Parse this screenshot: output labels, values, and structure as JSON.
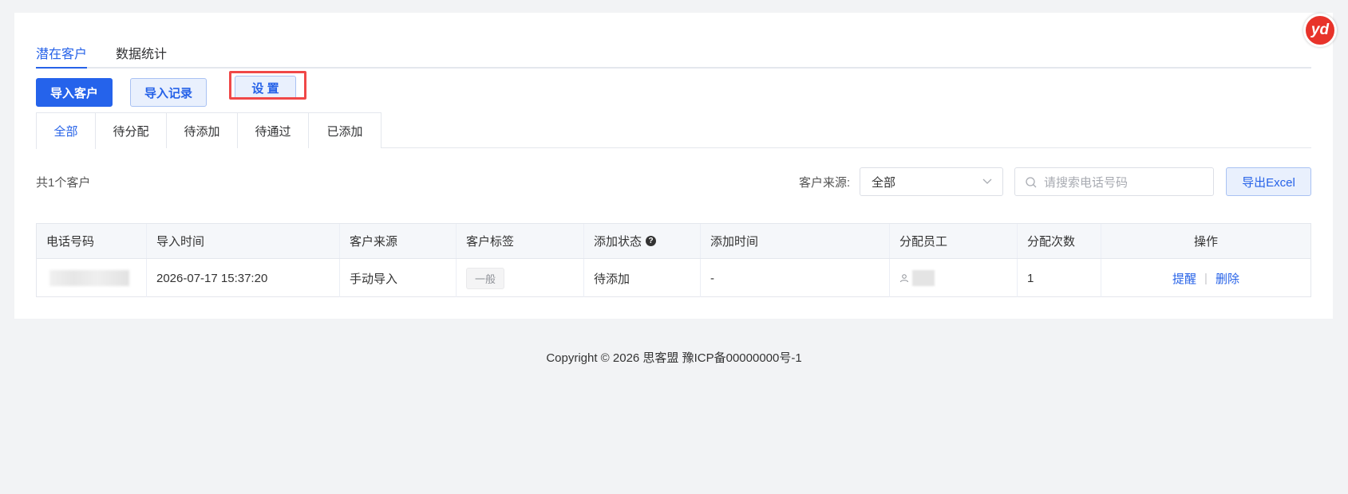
{
  "top_tabs": [
    "潜在客户",
    "数据统计"
  ],
  "actions": {
    "import_customers": "导入客户",
    "import_records": "导入记录",
    "settings": "设 置"
  },
  "status_tabs": [
    "全部",
    "待分配",
    "待添加",
    "待通过",
    "已添加"
  ],
  "summary": "共1个客户",
  "filter": {
    "source_label": "客户来源:",
    "source_value": "全部",
    "search_placeholder": "请搜索电话号码",
    "export_label": "导出Excel"
  },
  "table": {
    "headers": [
      "电话号码",
      "导入时间",
      "客户来源",
      "客户标签",
      "添加状态",
      "添加时间",
      "分配员工",
      "分配次数",
      "操作"
    ],
    "rows": [
      {
        "phone": "",
        "import_time": "2026-07-17 15:37:20",
        "source": "手动导入",
        "tag": "一般",
        "status": "待添加",
        "added_time": "-",
        "employee": "",
        "assign_count": "1",
        "actions": [
          "提醒",
          "删除"
        ]
      }
    ]
  },
  "footer": "Copyright © 2026 思客盟 豫ICP备00000000号-1",
  "badge": "yd",
  "colors": {
    "primary": "#2563eb",
    "highlight": "#f04848"
  }
}
